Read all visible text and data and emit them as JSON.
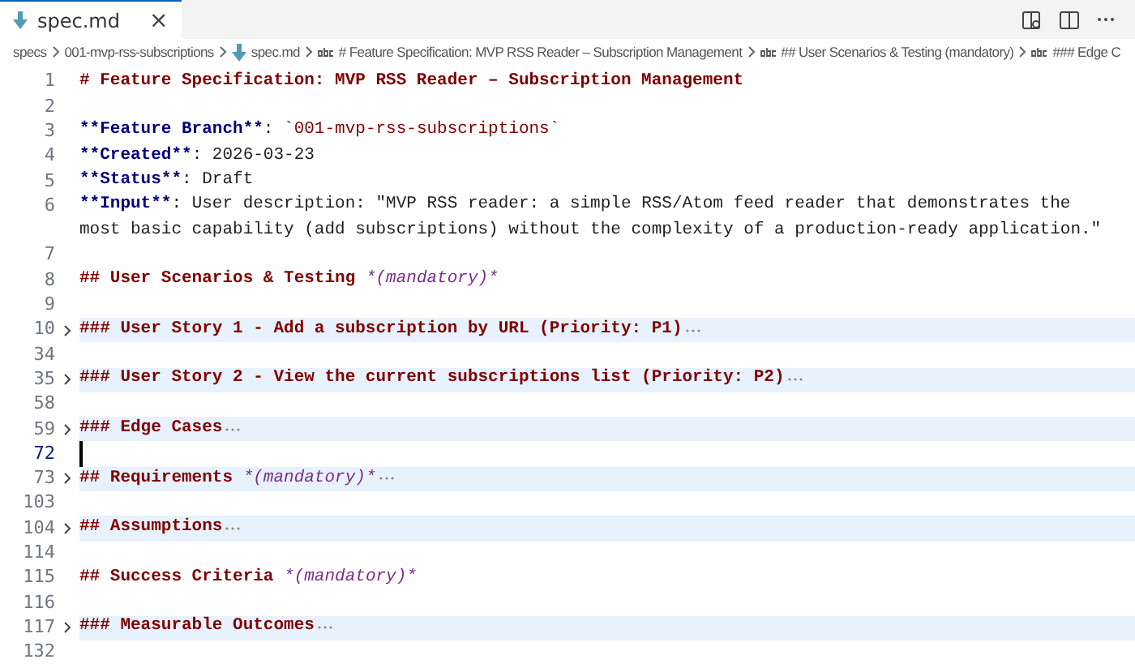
{
  "tab": {
    "label": "spec.md",
    "selected": true,
    "close": "×"
  },
  "breadcrumbs": [
    {
      "kind": "folder",
      "label": "specs"
    },
    {
      "kind": "folder",
      "label": "001-mvp-rss-subscriptions"
    },
    {
      "kind": "file",
      "label": "spec.md"
    },
    {
      "kind": "symbol",
      "label": "# Feature Specification: MVP RSS Reader – Subscription Management"
    },
    {
      "kind": "symbol",
      "label": "## User Scenarios & Testing (mandatory)"
    },
    {
      "kind": "symbol",
      "label": "### Edge C"
    }
  ],
  "lines": [
    {
      "number": "1",
      "segments": [
        {
          "kind": "heading",
          "text": "# Feature Specification: MVP RSS Reader – Subscription Management"
        }
      ]
    },
    {
      "number": "2"
    },
    {
      "number": "3",
      "segments": [
        {
          "kind": "bold",
          "text": "**Feature Branch**"
        },
        {
          "kind": "plain",
          "text": ": "
        },
        {
          "kind": "code",
          "text": "`001-mvp-rss-subscriptions`"
        }
      ]
    },
    {
      "number": "4",
      "segments": [
        {
          "kind": "bold",
          "text": "**Created**"
        },
        {
          "kind": "plain",
          "text": ": 2026-03-23"
        }
      ]
    },
    {
      "number": "5",
      "segments": [
        {
          "kind": "bold",
          "text": "**Status**"
        },
        {
          "kind": "plain",
          "text": ": Draft"
        }
      ]
    },
    {
      "number": "6",
      "segments": [
        {
          "kind": "bold",
          "text": "**Input**"
        },
        {
          "kind": "plain",
          "text": ": User description: \"MVP RSS reader: a simple RSS/Atom feed reader that demonstrates the"
        }
      ],
      "continuation": "most basic capability (add subscriptions) without the complexity of a production-ready application.\""
    },
    {
      "number": "7"
    },
    {
      "number": "8",
      "segments": [
        {
          "kind": "heading",
          "text": "## User Scenarios & Testing "
        },
        {
          "kind": "italic",
          "text": "*(mandatory)*"
        }
      ]
    },
    {
      "number": "9"
    },
    {
      "number": "10",
      "folded": true,
      "segments": [
        {
          "kind": "heading",
          "text": "### User Story 1 - Add a subscription by URL (Priority: P1)"
        }
      ]
    },
    {
      "number": "34"
    },
    {
      "number": "35",
      "folded": true,
      "segments": [
        {
          "kind": "heading",
          "text": "### User Story 2 - View the current subscriptions list (Priority: P2)"
        }
      ]
    },
    {
      "number": "58"
    },
    {
      "number": "59",
      "folded": true,
      "segments": [
        {
          "kind": "heading",
          "text": "### Edge Cases"
        }
      ]
    },
    {
      "number": "72",
      "cursor": true
    },
    {
      "number": "73",
      "folded": true,
      "segments": [
        {
          "kind": "heading",
          "text": "## Requirements "
        },
        {
          "kind": "italic",
          "text": "*(mandatory)*"
        }
      ]
    },
    {
      "number": "103"
    },
    {
      "number": "104",
      "folded": true,
      "segments": [
        {
          "kind": "heading",
          "text": "## Assumptions"
        }
      ]
    },
    {
      "number": "114"
    },
    {
      "number": "115",
      "segments": [
        {
          "kind": "heading",
          "text": "## Success Criteria "
        },
        {
          "kind": "italic",
          "text": "*(mandatory)*"
        }
      ]
    },
    {
      "number": "116"
    },
    {
      "number": "117",
      "folded": true,
      "segments": [
        {
          "kind": "heading",
          "text": "### Measurable Outcomes"
        }
      ]
    },
    {
      "number": "132"
    }
  ]
}
